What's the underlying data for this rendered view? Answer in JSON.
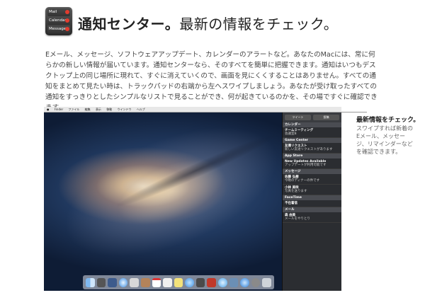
{
  "header": {
    "icon_rows": [
      "Mail",
      "Calendar",
      "Messages"
    ],
    "title_bold": "通知センター。",
    "title_rest": "最新の情報をチェック。"
  },
  "body": {
    "paragraph": "Eメール、メッセージ、ソフトウェアアップデート、カレンダーのアラートなど。あなたのMacには、常に何らかの新しい情報が届いています。通知センターなら、そのすべてを簡単に把握できます。通知はいつもデスクトップ上の同じ場所に現れて、すぐに消えていくので、画面を見にくくすることはありません。すべての通知をまとめて見たい時は、トラックパッドの右端から左へスワイプしましょう。あなたが受け取ったすべての通知をすっきりとしたシンプルなリストで見ることができ、何が起きているのかを、その場ですぐに確認できます。"
  },
  "screen": {
    "menubar": [
      "Finder",
      "ファイル",
      "編集",
      "表示",
      "移動",
      "ウインドウ",
      "ヘルプ"
    ],
    "nc_buttons": [
      "ツイート",
      "投稿"
    ],
    "sections": [
      {
        "name": "カレンダー",
        "items": [
          {
            "title": "チームミーティング",
            "text": "会議室B"
          }
        ]
      },
      {
        "name": "Game Center",
        "items": [
          {
            "title": "友達リクエスト",
            "text": "新しい友達リクエストがあります"
          }
        ]
      },
      {
        "name": "App Store",
        "items": [
          {
            "title": "New Updates Available",
            "text": "アップデートが利用可能です"
          }
        ]
      },
      {
        "name": "メッセージ",
        "items": [
          {
            "title": "佐藤 弘樹",
            "text": "今晩のディナーの件です"
          },
          {
            "title": "小林 美咲",
            "text": "写真を送ります"
          }
        ]
      },
      {
        "name": "FaceTime",
        "items": [
          {
            "title": "不在着信",
            "text": ""
          }
        ]
      },
      {
        "name": "メール",
        "items": [
          {
            "title": "森 由美",
            "text": "メールをやりとり"
          }
        ]
      }
    ]
  },
  "caption": {
    "title": "最新情報をチェック。",
    "body": "スワイプすれば新着のEメール、メッセージ、リマインダーなどを確認できます。"
  },
  "colors": {
    "nc_background": "#2b2d31",
    "badge_red": "#e23b2e"
  }
}
